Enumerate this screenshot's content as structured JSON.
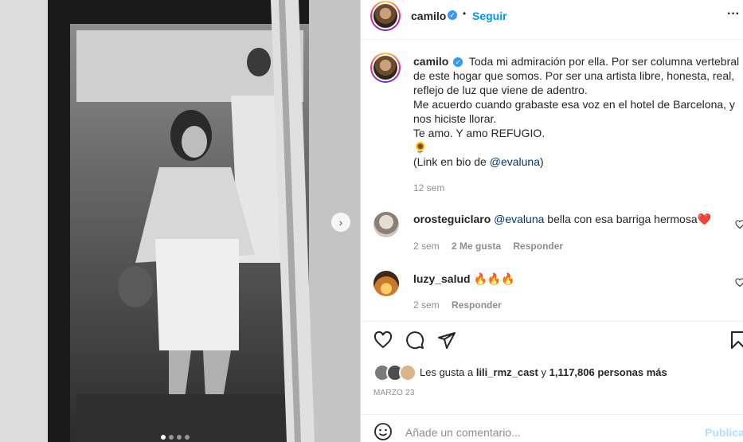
{
  "post": {
    "author": "camilo",
    "follow_label": "Seguir",
    "dot": "•",
    "more": "···"
  },
  "caption": {
    "author": "camilo",
    "lines": [
      "Toda mi admiración por ella. Por ser columna vertebral",
      "de este hogar que somos. Por ser una artista libre, honesta, real,",
      "reflejo de luz que viene de adentro.",
      "Me acuerdo cuando grabaste esa voz en el hotel de Barcelona, y",
      "nos hiciste llorar.",
      "Te amo. Y amo REFUGIO.",
      "🌻"
    ],
    "link_prefix": "(Link en bio de ",
    "link_handle": "@evaluna",
    "link_suffix": ")",
    "time": "12 sem"
  },
  "comments": [
    {
      "user": "orosteguiclaro",
      "mention": "@evaluna",
      "text": " bella con esa barriga hermosa",
      "emoji": "❤️",
      "time": "2 sem",
      "likes": "2 Me gusta",
      "reply": "Responder"
    },
    {
      "user": "luzy_salud",
      "text": "🔥🔥🔥",
      "time": "2 sem",
      "reply": "Responder"
    }
  ],
  "likes": {
    "prefix": "Les gusta a ",
    "user": "lili_rmz_cast",
    "middle": " y ",
    "count": "1,117,806 personas más"
  },
  "date": "MARZO 23",
  "comment_box": {
    "placeholder": "Añade un comentario...",
    "publish": "Publicar"
  },
  "carousel": {
    "dots": 4,
    "active": 0
  },
  "colors": {
    "accent": "#0095f6",
    "verified": "#3897f0",
    "muted": "#8e8e8e",
    "link": "#00376b"
  }
}
